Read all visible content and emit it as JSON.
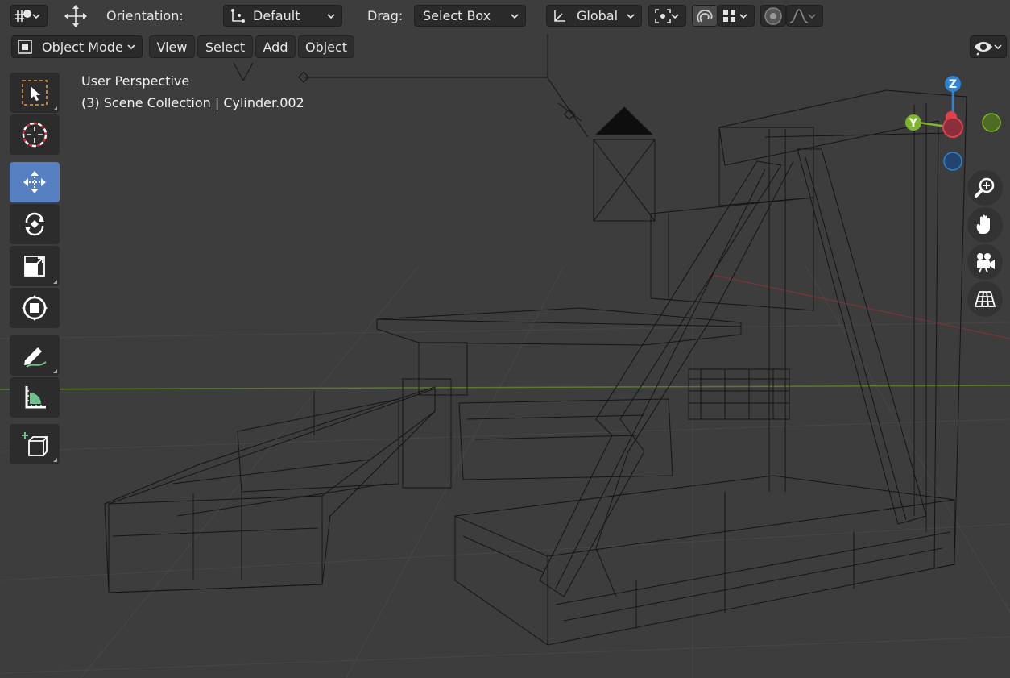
{
  "header": {
    "orientation_label": "Orientation:",
    "orientation_value": "Default",
    "drag_label": "Drag:",
    "drag_value": "Select Box",
    "transform_space": "Global"
  },
  "mode_bar": {
    "mode": "Object Mode",
    "menus": [
      "View",
      "Select",
      "Add",
      "Object"
    ]
  },
  "viewport": {
    "perspective_label": "User Perspective",
    "collection_label": "(3) Scene Collection | Cylinder.002"
  },
  "gizmo": {
    "z": "Z",
    "y": "Y"
  },
  "toolbar": {
    "tools": [
      "select-box",
      "cursor",
      "move",
      "rotate",
      "scale",
      "transform",
      "annotate",
      "measure",
      "add-cube"
    ],
    "active": "move"
  },
  "colors": {
    "viewport_bg": "#3d3d3d",
    "header_bg": "#303030",
    "active_tool": "#5680c2",
    "axis_x": "#e0404d",
    "axis_y": "#7eb52a",
    "axis_z": "#2e84d6"
  }
}
